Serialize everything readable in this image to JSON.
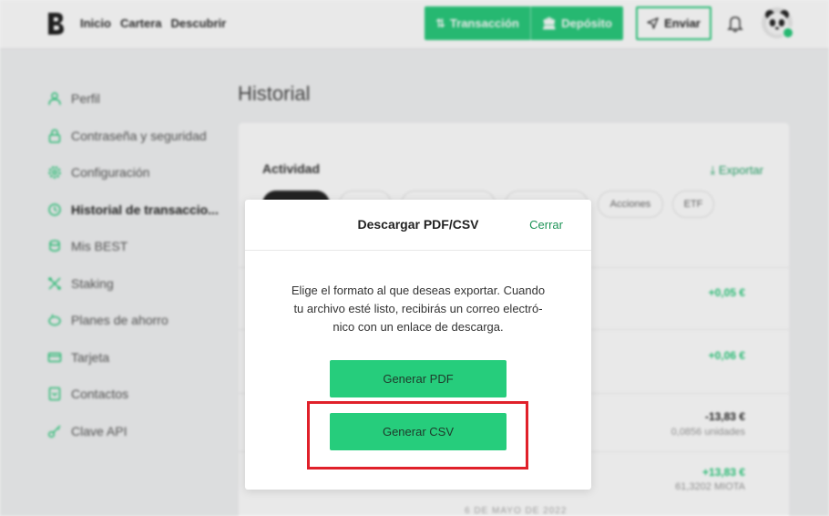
{
  "colors": {
    "accent": "#26c97a",
    "link": "#1e9457",
    "highlight": "#e0202a"
  },
  "topbar": {
    "logo_icon": "brand-b-logo-icon",
    "nav": [
      "Inicio",
      "Cartera",
      "Descubrir"
    ],
    "transaccion_label": "Transacción",
    "deposito_label": "Depósito",
    "enviar_label": "Enviar",
    "bell_icon": "bell-icon",
    "avatar_icon": "panda-avatar"
  },
  "sidebar": {
    "items": [
      {
        "label": "Perfil",
        "icon": "user-icon"
      },
      {
        "label": "Contraseña y seguridad",
        "icon": "lock-icon"
      },
      {
        "label": "Configuración",
        "icon": "gear-icon"
      },
      {
        "label": "Historial de transaccio...",
        "icon": "history-icon"
      },
      {
        "label": "Mis BEST",
        "icon": "coins-icon"
      },
      {
        "label": "Staking",
        "icon": "staking-icon"
      },
      {
        "label": "Planes de ahorro",
        "icon": "piggy-bank-icon"
      },
      {
        "label": "Tarjeta",
        "icon": "card-icon"
      },
      {
        "label": "Contactos",
        "icon": "contacts-icon"
      },
      {
        "label": "Clave API",
        "icon": "key-icon"
      }
    ]
  },
  "main": {
    "title": "Historial",
    "card_title": "Actividad",
    "export_label": "Exportar",
    "chips": [
      "",
      "",
      "",
      "",
      "Acciones",
      "ETF"
    ],
    "rows": [
      {
        "amount": "+0,05 €",
        "sub": ""
      },
      {
        "amount": "+0,06 €",
        "sub": ""
      },
      {
        "amount": "-13,83 €",
        "sub": "0,0856 unidades"
      },
      {
        "amount": "+13,83 €",
        "sub": "61,3202 MIOTA"
      }
    ],
    "date_separator": "6 DE MAYO DE 2022"
  },
  "modal": {
    "title": "Descargar PDF/CSV",
    "close_label": "Cerrar",
    "text_lines": [
      "Elige el formato al que deseas exportar. Cuando",
      "tu archivo esté listo, recibirás un correo electró-",
      "nico con un enlace de descarga."
    ],
    "pdf_button": "Generar PDF",
    "csv_button": "Generar CSV"
  }
}
